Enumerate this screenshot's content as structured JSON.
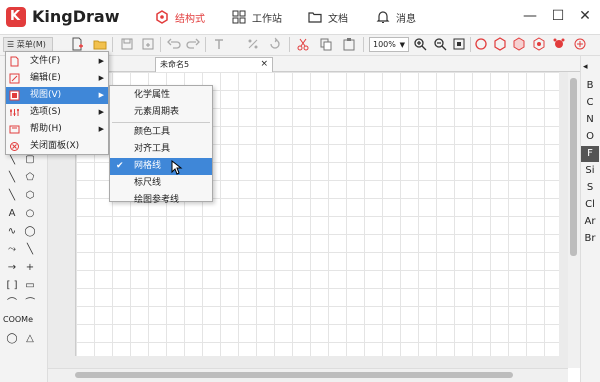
{
  "app": {
    "name": "KingDraw",
    "logo_letter": "K"
  },
  "nav": {
    "tabs": [
      {
        "label": "结构式",
        "icon": "molecule-icon",
        "active": true
      },
      {
        "label": "工作站",
        "icon": "grid-icon",
        "active": false
      },
      {
        "label": "文档",
        "icon": "folder-icon",
        "active": false
      },
      {
        "label": "消息",
        "icon": "bell-icon",
        "active": false
      }
    ]
  },
  "window": {
    "minimize": "—",
    "maximize": "☐",
    "close": "✕"
  },
  "toolbar": {
    "menu_label": "菜单(M)",
    "zoom": "100%"
  },
  "document": {
    "tab_title": "未命名5",
    "close": "×"
  },
  "main_menu": {
    "items": [
      {
        "label": "文件(F)",
        "icon": "file-icon",
        "submenu": true
      },
      {
        "label": "编辑(E)",
        "icon": "edit-icon",
        "submenu": true
      },
      {
        "label": "视图(V)",
        "icon": "view-icon",
        "submenu": true,
        "highlighted": true
      },
      {
        "label": "选项(S)",
        "icon": "options-icon",
        "submenu": true
      },
      {
        "label": "帮助(H)",
        "icon": "help-icon",
        "submenu": true
      },
      {
        "label": "关闭面板(X)",
        "icon": "close-panel-icon",
        "submenu": false
      }
    ]
  },
  "view_submenu": {
    "items": [
      {
        "label": "化学属性"
      },
      {
        "label": "元素周期表"
      },
      {
        "label": "颜色工具"
      },
      {
        "label": "对齐工具"
      },
      {
        "label": "网格线",
        "checked": true,
        "highlighted": true
      },
      {
        "label": "标尺线"
      },
      {
        "label": "绘图参考线"
      }
    ]
  },
  "elements": [
    "B",
    "C",
    "N",
    "O",
    "F",
    "Si",
    "S",
    "Cl",
    "Ar",
    "Br"
  ],
  "selected_element": "F",
  "left_tools": {
    "cooh_label": "COOMe"
  },
  "colors": {
    "accent": "#e23c3c",
    "highlight": "#3f87d8"
  }
}
